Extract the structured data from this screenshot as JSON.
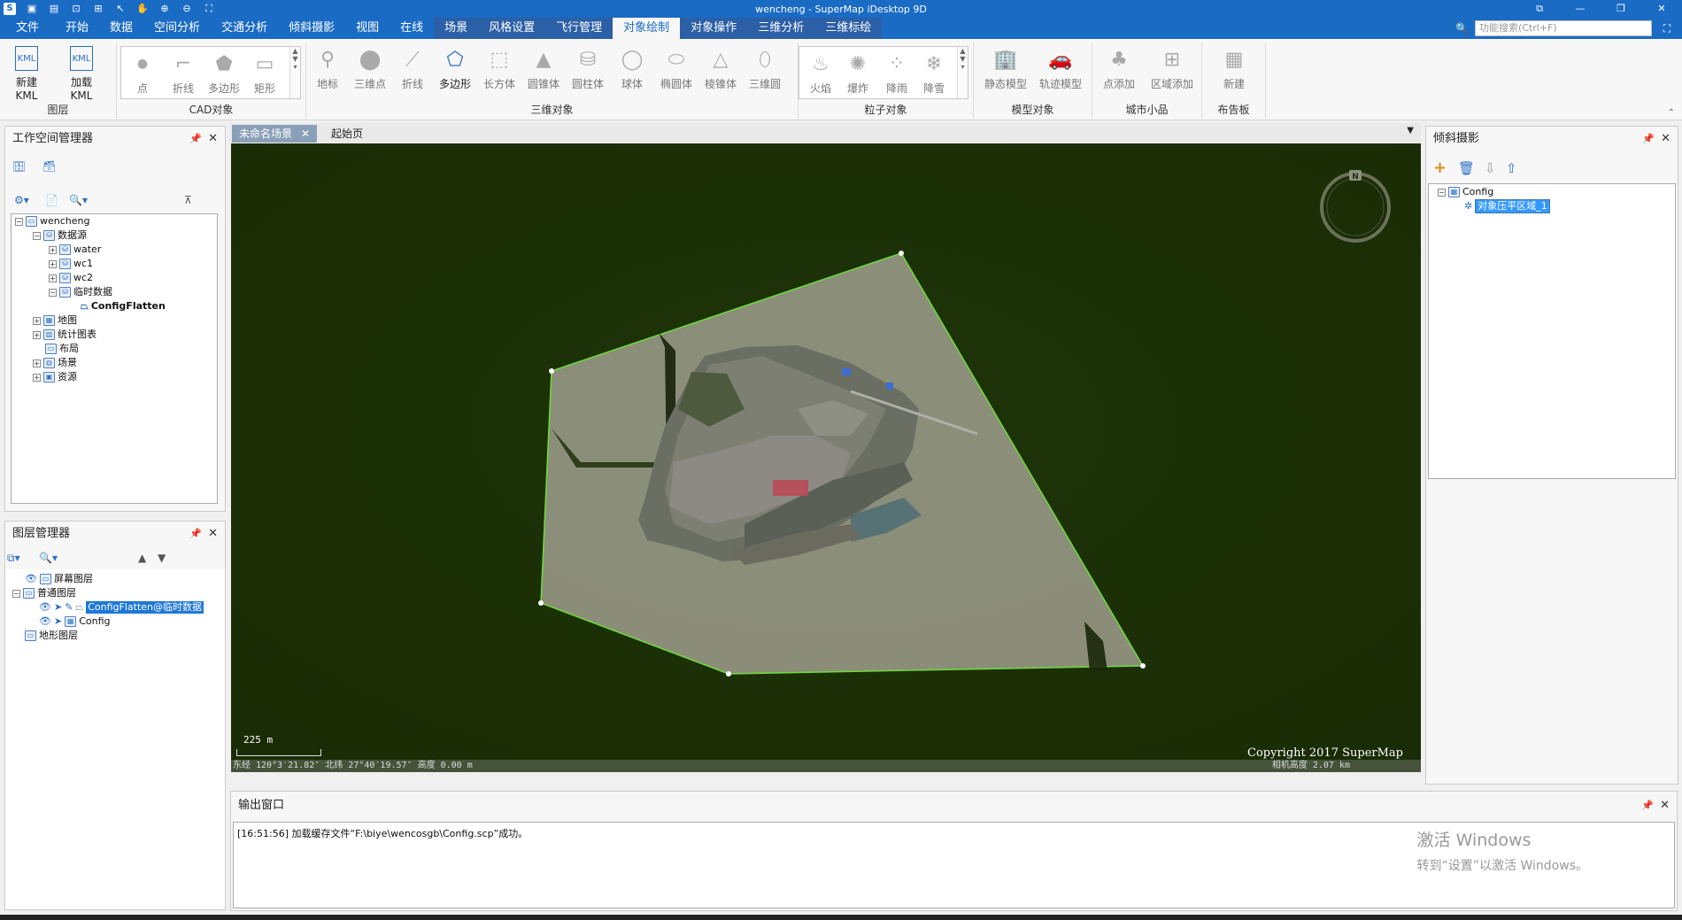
{
  "window": {
    "title": "wencheng - SuperMap iDesktop 9D",
    "controls": [
      "restore-icon",
      "minimize-icon",
      "maximize-icon",
      "close-icon"
    ]
  },
  "quick_access": [
    "app-icon",
    "save-icon",
    "save-as-icon",
    "export-icon",
    "open-icon",
    "pointer-icon",
    "pan-icon",
    "zoom-in-icon",
    "zoom-out-icon",
    "full-extent-icon"
  ],
  "menu": {
    "items": [
      "文件",
      "开始",
      "数据",
      "空间分析",
      "交通分析",
      "倾斜摄影",
      "视图",
      "在线",
      "场景",
      "风格设置",
      "飞行管理",
      "对象绘制",
      "对象操作",
      "三维分析",
      "三维标绘"
    ],
    "active_index": 11,
    "search_placeholder": "功能搜索(Ctrl+F)"
  },
  "ribbon": {
    "layer_group": {
      "label": "图层",
      "buttons": [
        "新建 KML",
        "加载KML"
      ]
    },
    "cad_group": {
      "label": "CAD对象",
      "buttons": [
        "点",
        "折线",
        "多边形",
        "矩形"
      ]
    },
    "threed_group": {
      "label": "三维对象",
      "buttons": [
        "地标",
        "三维点",
        "折线",
        "多边形",
        "长方体",
        "圆锥体",
        "圆柱体",
        "球体",
        "椭圆体",
        "棱锥体",
        "三维圆"
      ]
    },
    "particle_group": {
      "label": "粒子对象",
      "buttons": [
        "火焰",
        "爆炸",
        "降雨",
        "降雪"
      ]
    },
    "model_group": {
      "label": "模型对象",
      "buttons": [
        "静态模型",
        "轨迹模型"
      ]
    },
    "city_group": {
      "label": "城市小品",
      "buttons": [
        "点添加",
        "区域添加"
      ]
    },
    "board_group": {
      "label": "布告板",
      "buttons": [
        "新建"
      ]
    }
  },
  "workspace_manager": {
    "title": "工作空间管理器",
    "tree": {
      "root": "wencheng",
      "datasource_label": "数据源",
      "datasources": [
        "water",
        "wc1",
        "wc2",
        "临时数据"
      ],
      "dataset": "ConfigFlatten",
      "others": [
        "地图",
        "统计图表",
        "布局",
        "场景",
        "资源"
      ]
    }
  },
  "layer_manager": {
    "title": "图层管理器",
    "screen_layer": "屏幕图层",
    "normal_layer": "普通图层",
    "selected_layer": "ConfigFlatten@临时数据",
    "config_layer": "Config",
    "terrain_layer": "地形图层"
  },
  "doc_tabs": {
    "scene_tab": "未命名场景",
    "start_tab": "起始页"
  },
  "scene": {
    "scale": "225 m",
    "copyright": "Copyright 2017 SuperMap",
    "coords": "东经 120°3′21.82″   北纬 27°40′19.57″   高度 0.00 m",
    "camera_height": "相机高度 2.07 km",
    "compass_label": "N",
    "background_color": "#1e3207",
    "polygon_fill": "#9a9a88"
  },
  "oblique_panel": {
    "title": "倾斜摄影",
    "root": "Config",
    "child": "对象压平区域_1"
  },
  "output": {
    "title": "输出窗口",
    "line": "[16:51:56] 加载缓存文件“F:\\biye\\wencosgb\\Config.scp”成功。",
    "activate_1": "激活 Windows",
    "activate_2": "转到“设置”以激活 Windows。"
  }
}
